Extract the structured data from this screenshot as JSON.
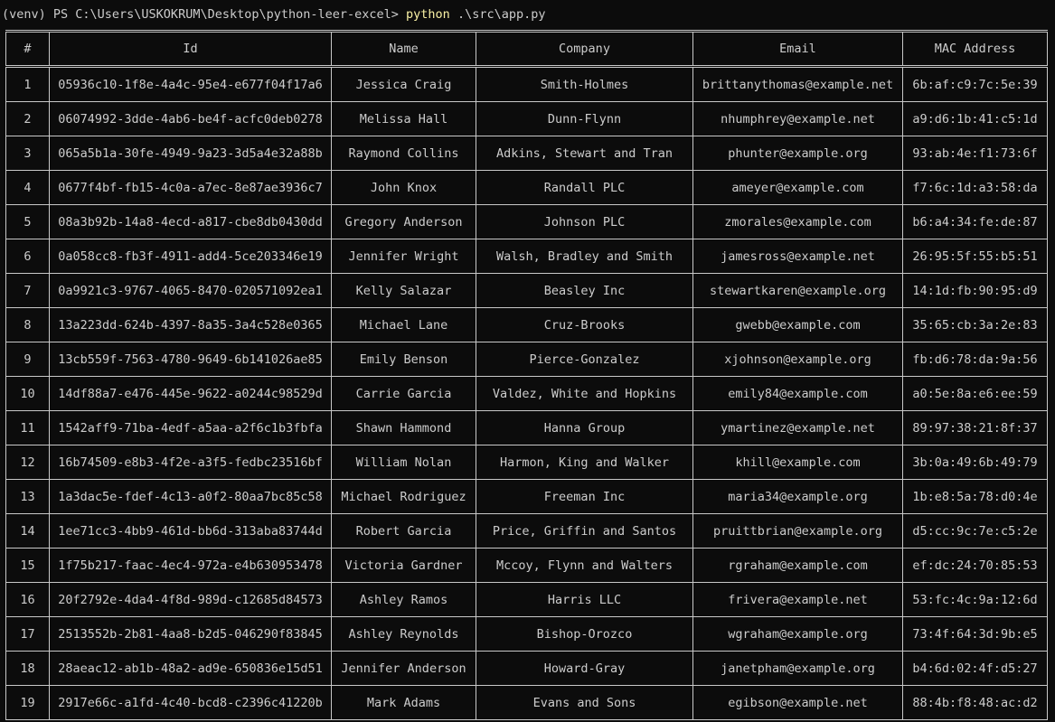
{
  "terminal": {
    "prompt": "(venv) PS C:\\Users\\USKOKRUM\\Desktop\\python-leer-excel> ",
    "command": "python",
    "args": " .\\src\\app.py",
    "command_color": "#f9f1a5"
  },
  "table": {
    "headers": [
      "#",
      "Id",
      "Name",
      "Company",
      "Email",
      "MAC Address"
    ],
    "rows": [
      [
        "1",
        "05936c10-1f8e-4a4c-95e4-e677f04f17a6",
        "Jessica Craig",
        "Smith-Holmes",
        "brittanythomas@example.net",
        "6b:af:c9:7c:5e:39"
      ],
      [
        "2",
        "06074992-3dde-4ab6-be4f-acfc0deb0278",
        "Melissa Hall",
        "Dunn-Flynn",
        "nhumphrey@example.net",
        "a9:d6:1b:41:c5:1d"
      ],
      [
        "3",
        "065a5b1a-30fe-4949-9a23-3d5a4e32a88b",
        "Raymond Collins",
        "Adkins, Stewart and Tran",
        "phunter@example.org",
        "93:ab:4e:f1:73:6f"
      ],
      [
        "4",
        "0677f4bf-fb15-4c0a-a7ec-8e87ae3936c7",
        "John Knox",
        "Randall PLC",
        "ameyer@example.com",
        "f7:6c:1d:a3:58:da"
      ],
      [
        "5",
        "08a3b92b-14a8-4ecd-a817-cbe8db0430dd",
        "Gregory Anderson",
        "Johnson PLC",
        "zmorales@example.com",
        "b6:a4:34:fe:de:87"
      ],
      [
        "6",
        "0a058cc8-fb3f-4911-add4-5ce203346e19",
        "Jennifer Wright",
        "Walsh, Bradley and Smith",
        "jamesross@example.net",
        "26:95:5f:55:b5:51"
      ],
      [
        "7",
        "0a9921c3-9767-4065-8470-020571092ea1",
        "Kelly Salazar",
        "Beasley Inc",
        "stewartkaren@example.org",
        "14:1d:fb:90:95:d9"
      ],
      [
        "8",
        "13a223dd-624b-4397-8a35-3a4c528e0365",
        "Michael Lane",
        "Cruz-Brooks",
        "gwebb@example.com",
        "35:65:cb:3a:2e:83"
      ],
      [
        "9",
        "13cb559f-7563-4780-9649-6b141026ae85",
        "Emily Benson",
        "Pierce-Gonzalez",
        "xjohnson@example.org",
        "fb:d6:78:da:9a:56"
      ],
      [
        "10",
        "14df88a7-e476-445e-9622-a0244c98529d",
        "Carrie Garcia",
        "Valdez, White and Hopkins",
        "emily84@example.com",
        "a0:5e:8a:e6:ee:59"
      ],
      [
        "11",
        "1542aff9-71ba-4edf-a5aa-a2f6c1b3fbfa",
        "Shawn Hammond",
        "Hanna Group",
        "ymartinez@example.net",
        "89:97:38:21:8f:37"
      ],
      [
        "12",
        "16b74509-e8b3-4f2e-a3f5-fedbc23516bf",
        "William Nolan",
        "Harmon, King and Walker",
        "khill@example.com",
        "3b:0a:49:6b:49:79"
      ],
      [
        "13",
        "1a3dac5e-fdef-4c13-a0f2-80aa7bc85c58",
        "Michael Rodriguez",
        "Freeman Inc",
        "maria34@example.org",
        "1b:e8:5a:78:d0:4e"
      ],
      [
        "14",
        "1ee71cc3-4bb9-461d-bb6d-313aba83744d",
        "Robert Garcia",
        "Price, Griffin and Santos",
        "pruittbrian@example.org",
        "d5:cc:9c:7e:c5:2e"
      ],
      [
        "15",
        "1f75b217-faac-4ec4-972a-e4b630953478",
        "Victoria Gardner",
        "Mccoy, Flynn and Walters",
        "rgraham@example.com",
        "ef:dc:24:70:85:53"
      ],
      [
        "16",
        "20f2792e-4da4-4f8d-989d-c12685d84573",
        "Ashley Ramos",
        "Harris LLC",
        "frivera@example.net",
        "53:fc:4c:9a:12:6d"
      ],
      [
        "17",
        "2513552b-2b81-4aa8-b2d5-046290f83845",
        "Ashley Reynolds",
        "Bishop-Orozco",
        "wgraham@example.org",
        "73:4f:64:3d:9b:e5"
      ],
      [
        "18",
        "28aeac12-ab1b-48a2-ad9e-650836e15d51",
        "Jennifer Anderson",
        "Howard-Gray",
        "janetpham@example.org",
        "b4:6d:02:4f:d5:27"
      ],
      [
        "19",
        "2917e66c-a1fd-4c40-bcd8-c2396c41220b",
        "Mark Adams",
        "Evans and Sons",
        "egibson@example.net",
        "88:4b:f8:48:ac:d2"
      ]
    ]
  }
}
